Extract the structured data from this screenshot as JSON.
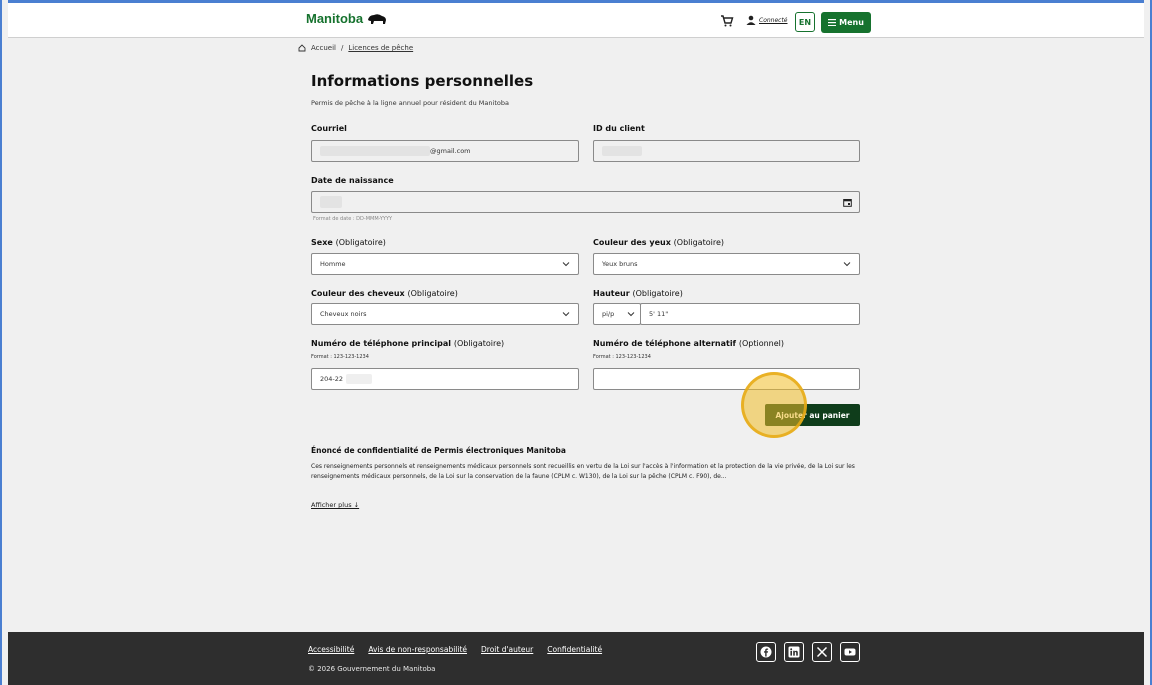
{
  "header": {
    "logo_text": "Manitoba",
    "user_link": "Connecté",
    "lang_label": "EN",
    "menu_label": "Menu"
  },
  "breadcrumb": {
    "home": "Accueil",
    "separator": "/",
    "current": "Licences de pêche"
  },
  "page": {
    "title": "Informations personnelles",
    "subtitle": "Permis de pêche à la ligne annuel pour résident du Manitoba"
  },
  "form": {
    "email": {
      "label": "Courriel",
      "value": "@gmail.com"
    },
    "client_id": {
      "label": "ID du client",
      "value": ""
    },
    "birth": {
      "label": "Date de naissance",
      "hint": "Format de date : DD-MMM-YYYY"
    },
    "sex": {
      "label": "Sexe",
      "required": "(Obligatoire)",
      "value": "Homme"
    },
    "eyes": {
      "label": "Couleur des yeux",
      "required": "(Obligatoire)",
      "value": "Yeux bruns"
    },
    "hair": {
      "label": "Couleur des cheveux",
      "required": "(Obligatoire)",
      "value": "Cheveux noirs"
    },
    "height": {
      "label": "Hauteur",
      "required": "(Obligatoire)",
      "unit": "pi/p",
      "value": "5' 11\""
    },
    "phone_main": {
      "label": "Numéro de téléphone principal",
      "required": "(Obligatoire)",
      "hint": "Format : 123-123-1234",
      "value": "204-22"
    },
    "phone_alt": {
      "label": "Numéro de téléphone alternatif",
      "required": "(Optionnel)",
      "hint": "Format : 123-123-1234",
      "value": ""
    },
    "add_to_cart": "Ajouter au panier"
  },
  "privacy": {
    "title": "Énoncé de confidentialité de Permis électroniques Manitoba",
    "text": "Ces renseignements personnels et renseignements médicaux personnels sont recueillis en vertu de la Loi sur l'accès à l'information et la protection de la vie privée, de la Loi sur les renseignements médicaux personnels, de la Loi sur la conservation de la faune (CPLM c. W130), de la Loi sur la pêche (CPLM c. F90), de...",
    "more": "Afficher plus ↓"
  },
  "footer": {
    "links": [
      "Accessibilité",
      "Avis de non-responsabilité",
      "Droit d'auteur",
      "Confidentialité"
    ],
    "copyright": "© 2026 Gouvernement du Manitoba"
  },
  "colors": {
    "brand_green": "#16722e",
    "button_dark": "#0f3d1b",
    "footer_bg": "#2e2e2e",
    "highlight": "#f0be28"
  }
}
